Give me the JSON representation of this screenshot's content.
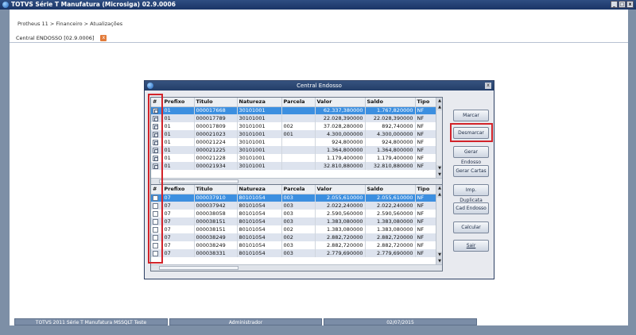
{
  "window": {
    "title": "TOTVS Série T Manufatura (Microsiga) 02.9.0006",
    "min_label": "_",
    "max_label": "□",
    "close_label": "x"
  },
  "breadcrumb": "Protheus 11 > Financeiro > Atualizações",
  "tab": {
    "label": "Central ENDOSSO [02.9.0006]",
    "close": "x"
  },
  "dialog": {
    "title": "Central Endosso",
    "close": "x"
  },
  "columns": [
    "#",
    "Prefixo",
    "Titulo",
    "Natureza",
    "Parcela",
    "Valor",
    "Saldo",
    "Tipo"
  ],
  "grid1_rows": [
    {
      "checked": true,
      "prefixo": "01",
      "titulo": "000017668",
      "natureza": "30101001",
      "parcela": "",
      "valor": "62.337,380000",
      "saldo": "1.767,820000",
      "tipo": "NF"
    },
    {
      "checked": true,
      "prefixo": "01",
      "titulo": "000017789",
      "natureza": "30101001",
      "parcela": "",
      "valor": "22.028,390000",
      "saldo": "22.028,390000",
      "tipo": "NF"
    },
    {
      "checked": true,
      "prefixo": "01",
      "titulo": "000017809",
      "natureza": "30101001",
      "parcela": "002",
      "valor": "37.028,280000",
      "saldo": "892,740000",
      "tipo": "NF"
    },
    {
      "checked": true,
      "prefixo": "01",
      "titulo": "000021023",
      "natureza": "30101001",
      "parcela": "001",
      "valor": "4.300,000000",
      "saldo": "4.300,000000",
      "tipo": "NF"
    },
    {
      "checked": true,
      "prefixo": "01",
      "titulo": "000021224",
      "natureza": "30101001",
      "parcela": "",
      "valor": "924,800000",
      "saldo": "924,800000",
      "tipo": "NF"
    },
    {
      "checked": true,
      "prefixo": "01",
      "titulo": "000021225",
      "natureza": "30101001",
      "parcela": "",
      "valor": "1.364,800000",
      "saldo": "1.364,800000",
      "tipo": "NF"
    },
    {
      "checked": true,
      "prefixo": "01",
      "titulo": "000021228",
      "natureza": "30101001",
      "parcela": "",
      "valor": "1.179,400000",
      "saldo": "1.179,400000",
      "tipo": "NF"
    },
    {
      "checked": true,
      "prefixo": "01",
      "titulo": "000021934",
      "natureza": "30101001",
      "parcela": "",
      "valor": "32.810,880000",
      "saldo": "32.810,880000",
      "tipo": "NF"
    }
  ],
  "grid2_rows": [
    {
      "checked": false,
      "prefixo": "07",
      "titulo": "000037910",
      "natureza": "80101054",
      "parcela": "003",
      "valor": "2.055,610000",
      "saldo": "2.055,610000",
      "tipo": "NF"
    },
    {
      "checked": false,
      "prefixo": "07",
      "titulo": "000037942",
      "natureza": "80101054",
      "parcela": "003",
      "valor": "2.022,240000",
      "saldo": "2.022,240000",
      "tipo": "NF"
    },
    {
      "checked": false,
      "prefixo": "07",
      "titulo": "000038058",
      "natureza": "80101054",
      "parcela": "003",
      "valor": "2.590,560000",
      "saldo": "2.590,560000",
      "tipo": "NF"
    },
    {
      "checked": false,
      "prefixo": "07",
      "titulo": "000038151",
      "natureza": "80101054",
      "parcela": "003",
      "valor": "1.383,080000",
      "saldo": "1.383,080000",
      "tipo": "NF"
    },
    {
      "checked": false,
      "prefixo": "07",
      "titulo": "000038151",
      "natureza": "80101054",
      "parcela": "002",
      "valor": "1.383,080000",
      "saldo": "1.383,080000",
      "tipo": "NF"
    },
    {
      "checked": false,
      "prefixo": "07",
      "titulo": "000038249",
      "natureza": "80101054",
      "parcela": "002",
      "valor": "2.882,720000",
      "saldo": "2.882,720000",
      "tipo": "NF"
    },
    {
      "checked": false,
      "prefixo": "07",
      "titulo": "000038249",
      "natureza": "80101054",
      "parcela": "003",
      "valor": "2.882,720000",
      "saldo": "2.882,720000",
      "tipo": "NF"
    },
    {
      "checked": false,
      "prefixo": "07",
      "titulo": "000038331",
      "natureza": "80101054",
      "parcela": "003",
      "valor": "2.779,690000",
      "saldo": "2.779,690000",
      "tipo": "NF"
    }
  ],
  "buttons": {
    "marcar": "Marcar",
    "desmarcar": "Desmarcar",
    "gerar_endosso": "Gerar Endosso",
    "gerar_cartas": "Gerar Cartas",
    "imp_duplicata": "Imp. Duplicata",
    "cad_endosso": "Cad Endosso",
    "calcular": "Calcular",
    "sair": "Sair"
  },
  "status": {
    "environment": "TOTVS 2011 Série T Manufatura MSSQLT Teste",
    "user": "Administrador",
    "date": "02/07/2015"
  },
  "colors": {
    "selected_row": "#3c8fe0",
    "highlight_box": "#d2232a",
    "title_bar": "#2f4e82"
  }
}
